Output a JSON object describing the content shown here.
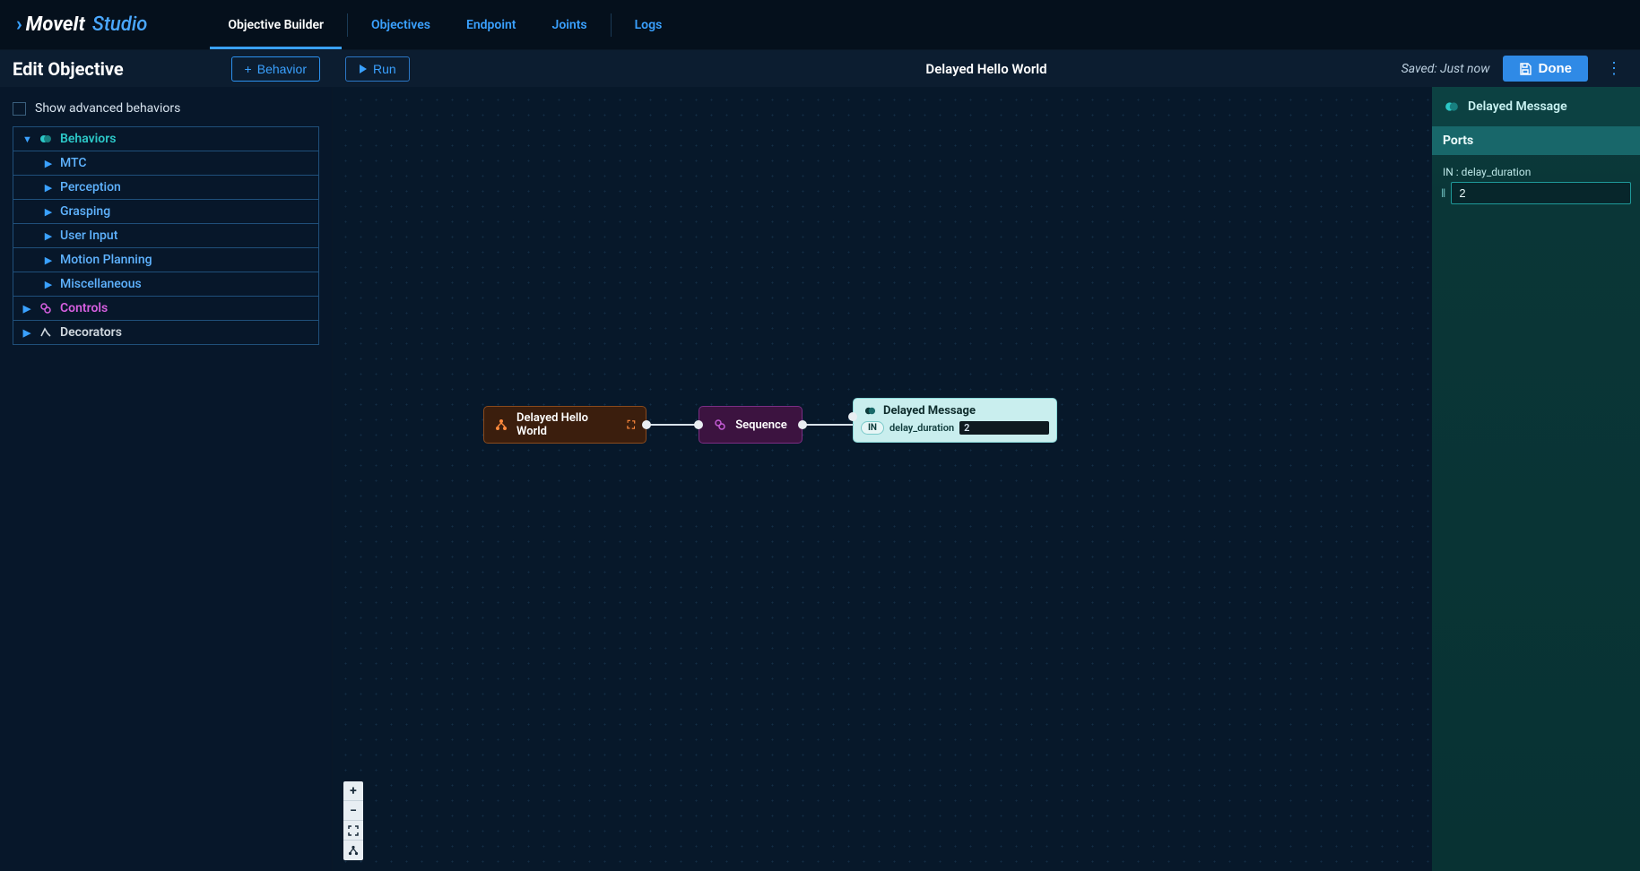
{
  "nav": {
    "logo_move": "MoveIt",
    "logo_studio": "Studio",
    "tabs": [
      "Objective Builder",
      "Objectives",
      "Endpoint",
      "Joints",
      "Logs"
    ],
    "active_tab": "Objective Builder"
  },
  "bar": {
    "title": "Edit Objective",
    "behavior_btn": "Behavior",
    "run_btn": "Run",
    "objective_name": "Delayed Hello World",
    "saved_text": "Saved: Just now",
    "done_btn": "Done"
  },
  "sidebar": {
    "show_advanced_label": "Show advanced behaviors",
    "categories": {
      "behaviors": {
        "label": "Behaviors",
        "children": [
          "MTC",
          "Perception",
          "Grasping",
          "User Input",
          "Motion Planning",
          "Miscellaneous"
        ]
      },
      "controls": {
        "label": "Controls"
      },
      "decorators": {
        "label": "Decorators"
      }
    }
  },
  "canvas": {
    "root": {
      "label": "Delayed Hello World"
    },
    "sequence": {
      "label": "Sequence"
    },
    "message_node": {
      "title": "Delayed Message",
      "port_badge": "IN",
      "port_name": "delay_duration",
      "port_value": "2"
    }
  },
  "right": {
    "title": "Delayed Message",
    "section": "Ports",
    "port_label": "IN : delay_duration",
    "port_value": "2"
  },
  "zoom": {
    "plus": "+",
    "minus": "−",
    "fit": "⛶",
    "tree": "⋔"
  }
}
